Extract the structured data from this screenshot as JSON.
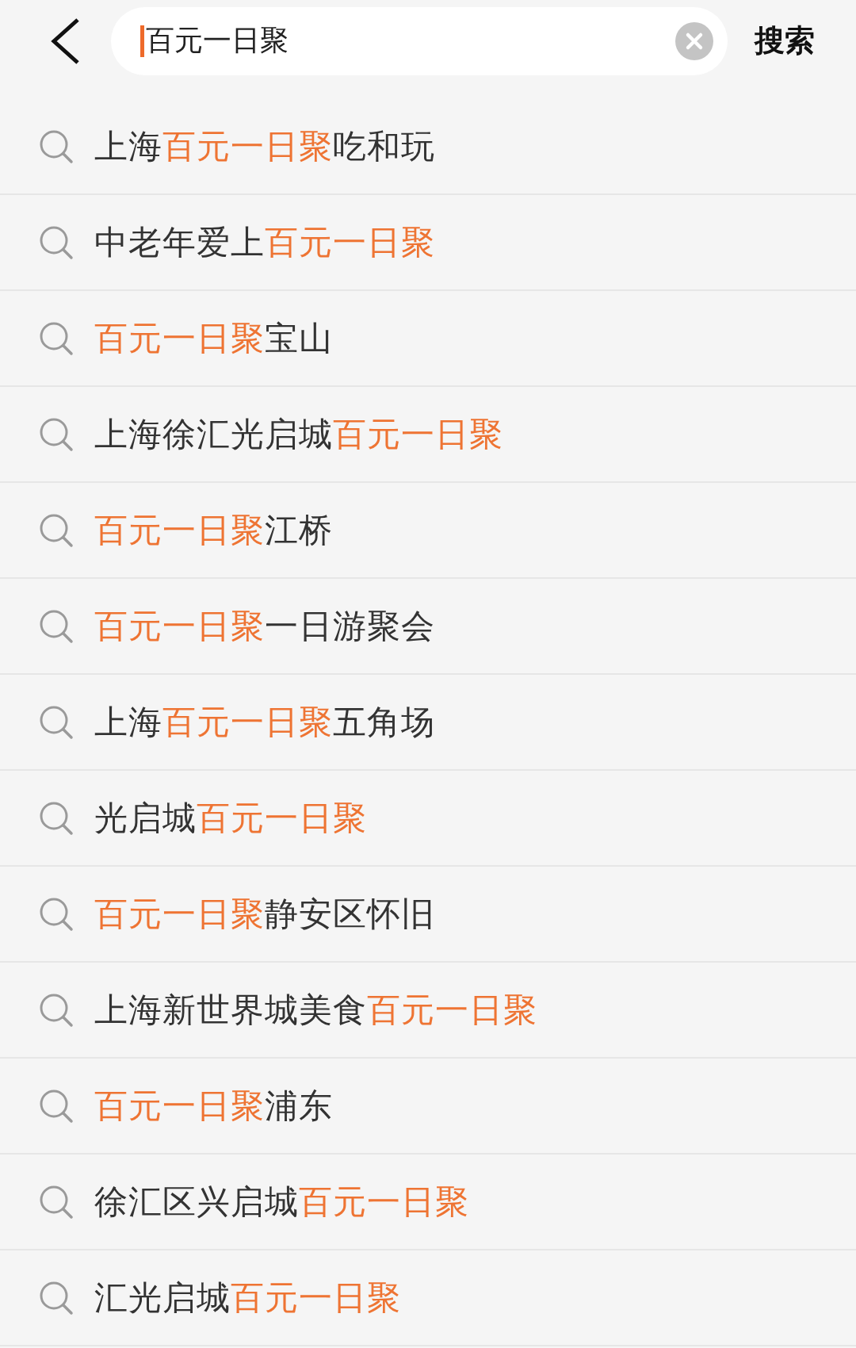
{
  "search": {
    "value": "百元一日聚",
    "button": "搜索"
  },
  "suggestions": [
    [
      {
        "text": "上海",
        "highlight": false
      },
      {
        "text": "百元一日聚",
        "highlight": true
      },
      {
        "text": "吃和玩",
        "highlight": false
      }
    ],
    [
      {
        "text": "中老年爱上",
        "highlight": false
      },
      {
        "text": "百元一日聚",
        "highlight": true
      }
    ],
    [
      {
        "text": "百元一日聚",
        "highlight": true
      },
      {
        "text": "宝山",
        "highlight": false
      }
    ],
    [
      {
        "text": "上海徐汇光启城",
        "highlight": false
      },
      {
        "text": "百元一日聚",
        "highlight": true
      }
    ],
    [
      {
        "text": "百元一日聚",
        "highlight": true
      },
      {
        "text": "江桥",
        "highlight": false
      }
    ],
    [
      {
        "text": "百元一日聚",
        "highlight": true
      },
      {
        "text": "一日游聚会",
        "highlight": false
      }
    ],
    [
      {
        "text": "上海",
        "highlight": false
      },
      {
        "text": "百元一日聚",
        "highlight": true
      },
      {
        "text": "五角场",
        "highlight": false
      }
    ],
    [
      {
        "text": "光启城",
        "highlight": false
      },
      {
        "text": "百元一日聚",
        "highlight": true
      }
    ],
    [
      {
        "text": "百元一日聚",
        "highlight": true
      },
      {
        "text": "静安区怀旧",
        "highlight": false
      }
    ],
    [
      {
        "text": "上海新世界城美食",
        "highlight": false
      },
      {
        "text": "百元一日聚",
        "highlight": true
      }
    ],
    [
      {
        "text": "百元一日聚",
        "highlight": true
      },
      {
        "text": "浦东",
        "highlight": false
      }
    ],
    [
      {
        "text": "徐汇区兴启城",
        "highlight": false
      },
      {
        "text": "百元一日聚",
        "highlight": true
      }
    ],
    [
      {
        "text": "汇光启城",
        "highlight": false
      },
      {
        "text": "百元一日聚",
        "highlight": true
      }
    ]
  ]
}
